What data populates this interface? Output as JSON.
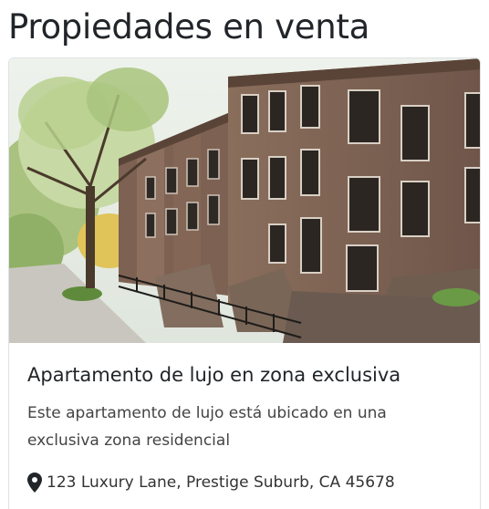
{
  "page": {
    "heading": "Propiedades en venta"
  },
  "listing": {
    "title": "Apartamento de lujo en zona exclusiva",
    "description": "Este apartamento de lujo está ubicado en una exclusiva zona residencial",
    "address": "123 Luxury Lane, Prestige Suburb, CA 45678",
    "address_icon": "map-pin-icon",
    "image_icon": "brownstone-row-photo"
  }
}
